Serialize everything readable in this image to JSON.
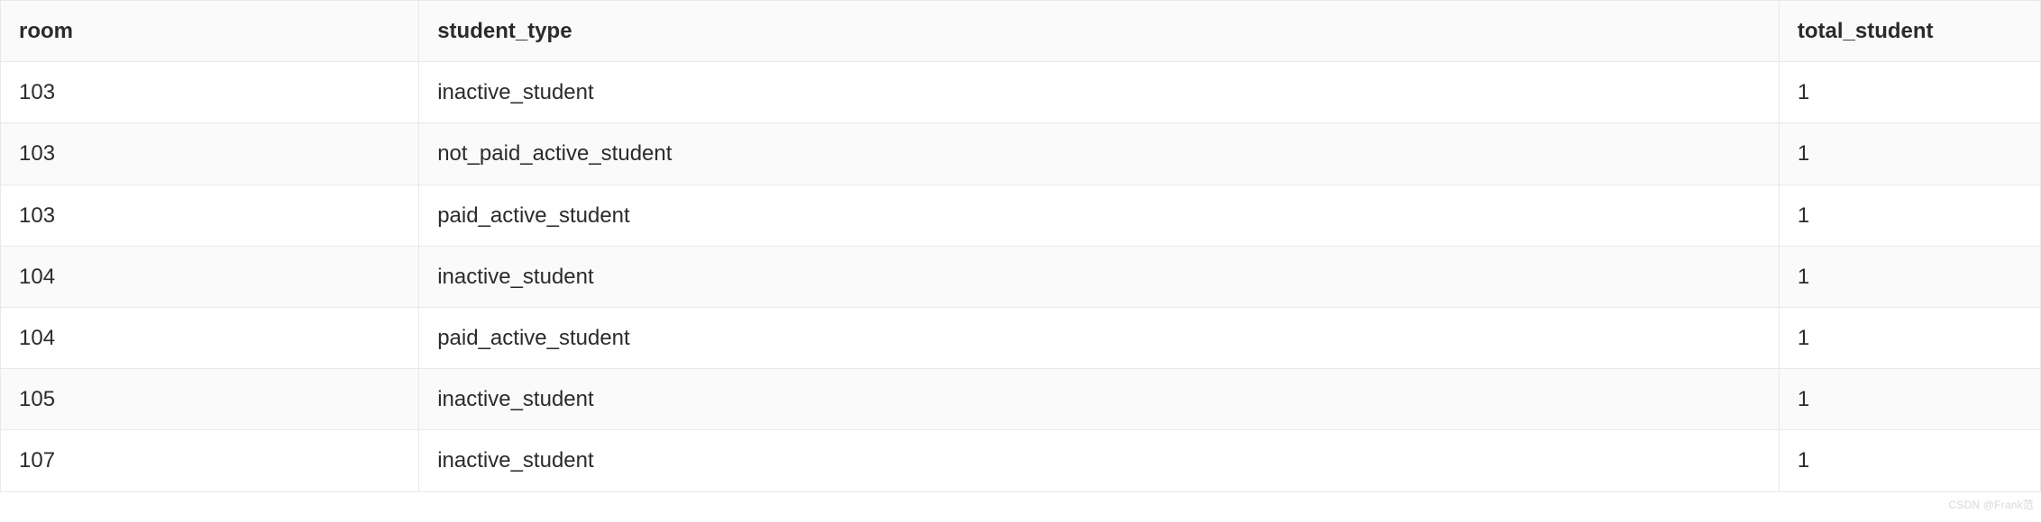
{
  "chart_data": {
    "type": "table",
    "columns": [
      "room",
      "student_type",
      "total_student"
    ],
    "rows": [
      {
        "room": "103",
        "student_type": "inactive_student",
        "total_student": "1"
      },
      {
        "room": "103",
        "student_type": "not_paid_active_student",
        "total_student": "1"
      },
      {
        "room": "103",
        "student_type": "paid_active_student",
        "total_student": "1"
      },
      {
        "room": "104",
        "student_type": "inactive_student",
        "total_student": "1"
      },
      {
        "room": "104",
        "student_type": "paid_active_student",
        "total_student": "1"
      },
      {
        "room": "105",
        "student_type": "inactive_student",
        "total_student": "1"
      },
      {
        "room": "107",
        "student_type": "inactive_student",
        "total_student": "1"
      }
    ]
  },
  "headers": {
    "room": "room",
    "student_type": "student_type",
    "total_student": "total_student"
  },
  "watermark": "CSDN @Frank范"
}
